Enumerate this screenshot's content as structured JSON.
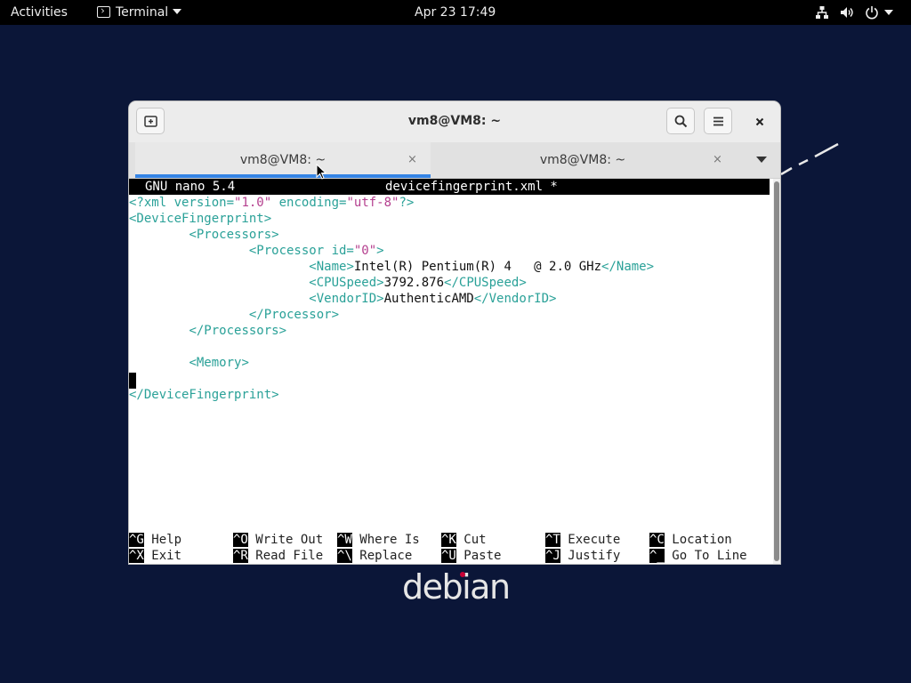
{
  "topbar": {
    "activities": "Activities",
    "app_name": "Terminal",
    "clock": "Apr 23  17:49"
  },
  "window": {
    "title": "vm8@VM8: ~",
    "tabs": [
      {
        "label": "vm8@VM8: ~",
        "close": "×",
        "active": true
      },
      {
        "label": "vm8@VM8: ~",
        "close": "×",
        "active": false
      }
    ]
  },
  "nano": {
    "version": "GNU nano 5.4",
    "filename": "devicefingerprint.xml *",
    "lines": [
      {
        "parts": [
          [
            "p",
            "<?xml version="
          ],
          [
            "v",
            "\"1.0\""
          ],
          [
            "p",
            " encoding="
          ],
          [
            "v",
            "\"utf-8\""
          ],
          [
            "p",
            "?>"
          ]
        ]
      },
      {
        "parts": [
          [
            "p",
            "<DeviceFingerprint>"
          ]
        ]
      },
      {
        "parts": [
          [
            "s",
            "        "
          ],
          [
            "p",
            "<Processors>"
          ]
        ]
      },
      {
        "parts": [
          [
            "s",
            "                "
          ],
          [
            "p",
            "<Processor id="
          ],
          [
            "v",
            "\"0\""
          ],
          [
            "p",
            ">"
          ]
        ]
      },
      {
        "parts": [
          [
            "s",
            "                        "
          ],
          [
            "p",
            "<Name>"
          ],
          [
            "t",
            "Intel(R) Pentium(R) 4   @ 2.0 GHz"
          ],
          [
            "p",
            "</Name>"
          ]
        ]
      },
      {
        "parts": [
          [
            "s",
            "                        "
          ],
          [
            "p",
            "<CPUSpeed>"
          ],
          [
            "t",
            "3792.876"
          ],
          [
            "p",
            "</CPUSpeed>"
          ]
        ]
      },
      {
        "parts": [
          [
            "s",
            "                        "
          ],
          [
            "p",
            "<VendorID>"
          ],
          [
            "t",
            "AuthenticAMD"
          ],
          [
            "p",
            "</VendorID>"
          ]
        ]
      },
      {
        "parts": [
          [
            "s",
            "                "
          ],
          [
            "p",
            "</Processor>"
          ]
        ]
      },
      {
        "parts": [
          [
            "s",
            "        "
          ],
          [
            "p",
            "</Processors>"
          ]
        ]
      },
      {
        "parts": []
      },
      {
        "parts": [
          [
            "s",
            "        "
          ],
          [
            "p",
            "<Memory>"
          ]
        ]
      },
      {
        "parts": []
      },
      {
        "parts": [
          [
            "p",
            "</DeviceFingerprint>"
          ]
        ]
      }
    ],
    "shortcuts_row1": [
      {
        "key": "^G",
        "label": "Help"
      },
      {
        "key": "^O",
        "label": "Write Out"
      },
      {
        "key": "^W",
        "label": "Where Is"
      },
      {
        "key": "^K",
        "label": "Cut"
      },
      {
        "key": "^T",
        "label": "Execute"
      },
      {
        "key": "^C",
        "label": "Location"
      }
    ],
    "shortcuts_row2": [
      {
        "key": "^X",
        "label": "Exit"
      },
      {
        "key": "^R",
        "label": "Read File"
      },
      {
        "key": "^\\",
        "label": "Replace"
      },
      {
        "key": "^U",
        "label": "Paste"
      },
      {
        "key": "^J",
        "label": "Justify"
      },
      {
        "key": "^_",
        "label": "Go To Line"
      }
    ]
  },
  "desktop": {
    "logo_text": "debian"
  },
  "colors": {
    "tag": "#2aa198",
    "attr_value": "#b5408f",
    "accent": "#3584e4",
    "wallpaper": "#0b1638"
  }
}
